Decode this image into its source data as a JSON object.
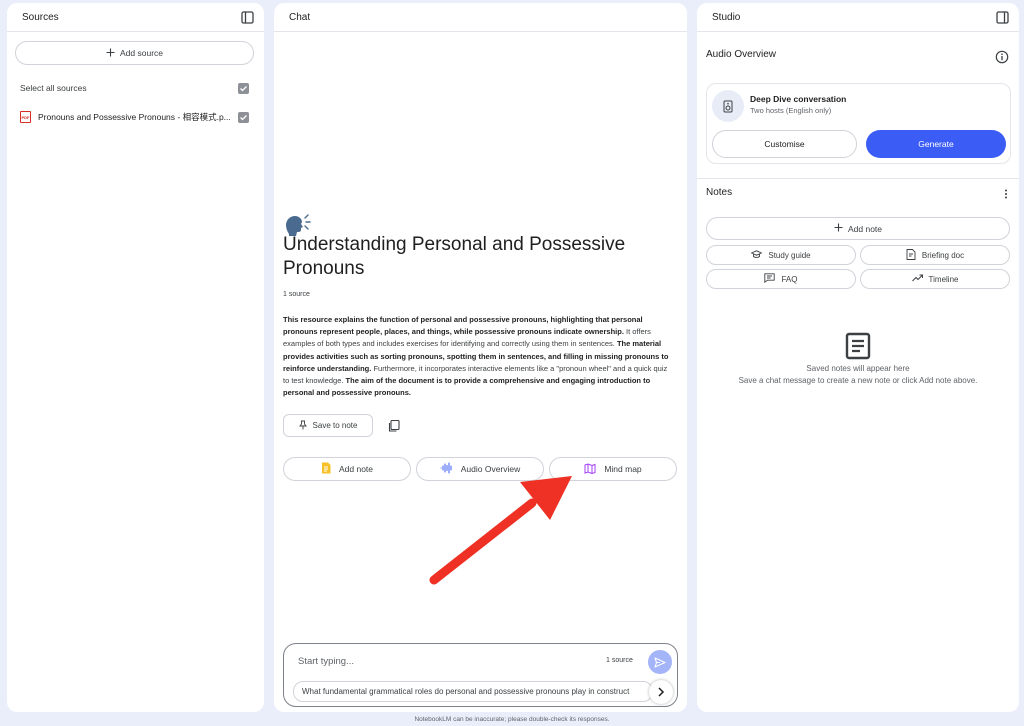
{
  "sources": {
    "title": "Sources",
    "add_source_label": "Add source",
    "select_all_label": "Select all sources",
    "items": [
      {
        "label": "Pronouns and Possessive Pronouns - 相容模式.p...",
        "icon": "pdf-icon",
        "checked": true
      }
    ]
  },
  "chat": {
    "title": "Chat",
    "emoji": "🗣️",
    "doc_title": "Understanding Personal and Possessive Pronouns",
    "source_count": "1 source",
    "summary": [
      {
        "text": "This resource explains the function of personal and possessive pronouns, highlighting that personal pronouns represent people, places, and things, while possessive pronouns indicate ownership.",
        "bold": true
      },
      {
        "text": " It offers examples of both types and includes exercises for identifying and correctly using them in sentences. ",
        "bold": false
      },
      {
        "text": "The material provides activities such as sorting pronouns, spotting them in sentences, and filling in missing pronouns to reinforce understanding.",
        "bold": true
      },
      {
        "text": " Furthermore, it incorporates interactive elements like a \"pronoun wheel\" and a quick quiz to test knowledge. ",
        "bold": false
      },
      {
        "text": "The aim of the document is to provide a comprehensive and engaging introduction to personal and possessive pronouns.",
        "bold": true
      }
    ],
    "save_to_note_label": "Save to note",
    "add_note_label": "Add note",
    "audio_overview_label": "Audio Overview",
    "mind_map_label": "Mind map",
    "composer_placeholder": "Start typing...",
    "composer_source_count": "1 source",
    "suggestion": "What fundamental grammatical roles do personal and possessive pronouns play in construct"
  },
  "footer": "NotebookLM can be inaccurate; please double-check its responses.",
  "studio": {
    "title": "Studio",
    "audio_overview_title": "Audio Overview",
    "card_title": "Deep Dive conversation",
    "card_subtitle": "Two hosts (English only)",
    "customise_label": "Customise",
    "generate_label": "Generate",
    "notes_title": "Notes",
    "add_note_label": "Add note",
    "chips": {
      "study_guide": "Study guide",
      "briefing_doc": "Briefing doc",
      "faq": "FAQ",
      "timeline": "Timeline"
    },
    "empty_title": "Saved notes will appear here",
    "empty_subtitle": "Save a chat message to create a new note or click Add note above."
  },
  "colors": {
    "background": "#eaeefa",
    "primary": "#3c5cf6",
    "arrow": "#ee3124",
    "send_disabled": "#a4b4f8"
  }
}
